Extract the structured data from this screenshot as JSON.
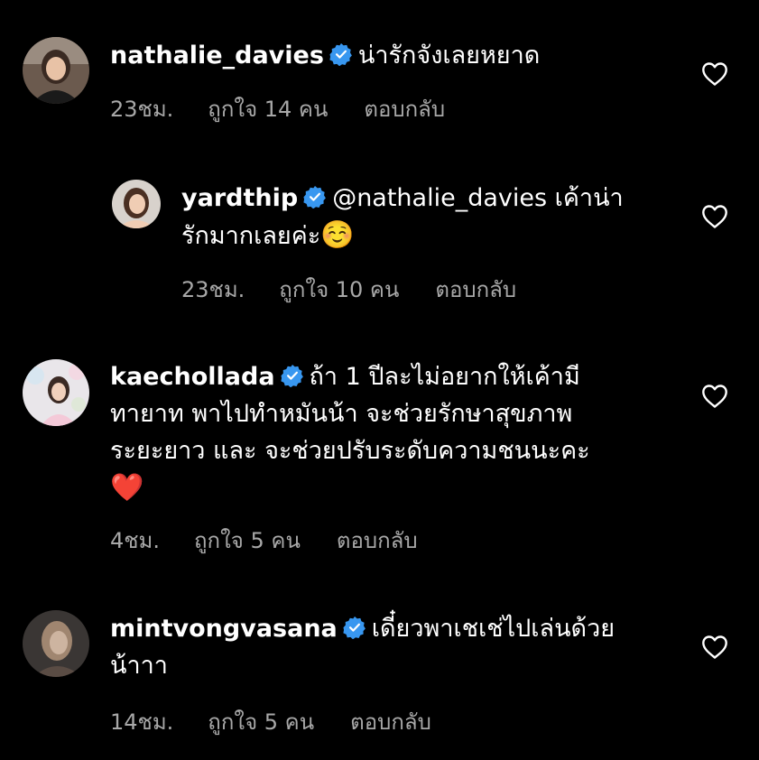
{
  "colors": {
    "background": "#000000",
    "text": "#ffffff",
    "meta": "#a8a8a8",
    "verified": "#3897f0",
    "heart_emoji": "#e02424"
  },
  "comments": [
    {
      "username": "nathalie_davies",
      "verified": true,
      "text": "น่ารักจังเลยหยาด",
      "time": "23ชม.",
      "likes": "ถูกใจ 14 คน",
      "reply": "ตอบกลับ",
      "icon": "heart-outline-icon"
    },
    {
      "username": "yardthip",
      "verified": true,
      "mention": "@nathalie_davies",
      "text_line1_rest": "เค้าน่า",
      "text_line2": "รักมากเลยค่ะ",
      "emoji": "☺️",
      "time": "23ชม.",
      "likes": "ถูกใจ 10 คน",
      "reply": "ตอบกลับ",
      "icon": "heart-outline-icon"
    },
    {
      "username": "kaechollada",
      "verified": true,
      "text_line1_rest": "ถ้า 1 ปีละไม่อยากให้เค้ามี",
      "text_line2": "ทายาท พาไปทำหมันน้า จะช่วยรักษาสุขภาพ",
      "text_line3": "ระยะยาว และ จะช่วยปรับระดับความชนนะคะ",
      "emoji": "❤️",
      "time": "4ชม.",
      "likes": "ถูกใจ 5 คน",
      "reply": "ตอบกลับ",
      "icon": "heart-outline-icon"
    },
    {
      "username": "mintvongvasana",
      "verified": true,
      "text_line1_rest": "เดี๋ยวพาเชเช่ไปเล่นด้วย",
      "text_line2": "น้าาา",
      "time": "14ชม.",
      "likes": "ถูกใจ 5 คน",
      "reply": "ตอบกลับ",
      "icon": "heart-outline-icon"
    }
  ]
}
